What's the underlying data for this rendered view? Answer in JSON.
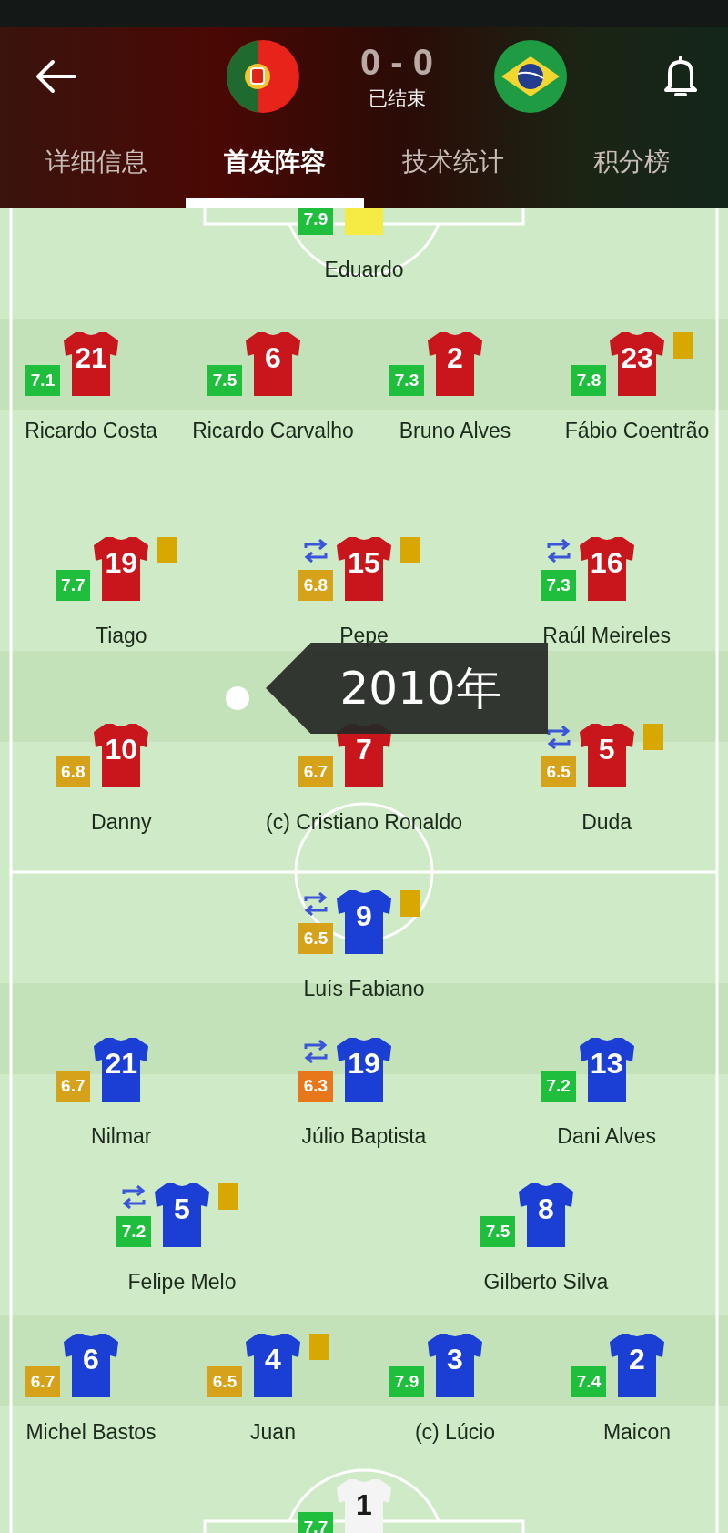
{
  "header": {
    "score": "0 - 0",
    "status": "已结束"
  },
  "tabs": [
    {
      "label": "详细信息",
      "selected": false
    },
    {
      "label": "首发阵容",
      "selected": true
    },
    {
      "label": "技术统计",
      "selected": false
    },
    {
      "label": "积分榜",
      "selected": false
    }
  ],
  "teams": [
    {
      "color": "#c9161c",
      "goalkeeper": {
        "name": "Eduardo",
        "rating": "7.9",
        "color": "#1fbe3c",
        "jersey": {
          "color": "#f6ea45"
        }
      },
      "lines": [
        [
          {
            "name": "Ricardo Costa",
            "number": "21",
            "rating": "7.1",
            "color": "#1fbe3c",
            "substituted": false,
            "yellow_card": false
          },
          {
            "name": "Ricardo Carvalho",
            "number": "6",
            "rating": "7.5",
            "color": "#1fbe3c",
            "substituted": false,
            "yellow_card": false
          },
          {
            "name": "Bruno Alves",
            "number": "2",
            "rating": "7.3",
            "color": "#1fbe3c",
            "substituted": false,
            "yellow_card": false
          },
          {
            "name": "Fábio Coentrão",
            "number": "23",
            "rating": "7.8",
            "color": "#1fbe3c",
            "substituted": false,
            "yellow_card": true
          }
        ],
        [
          {
            "name": "Tiago",
            "number": "19",
            "rating": "7.7",
            "color": "#1fbe3c",
            "substituted": false,
            "yellow_card": true
          },
          {
            "name": "Pepe",
            "number": "15",
            "rating": "6.8",
            "color": "#d6a21a",
            "substituted": true,
            "yellow_card": true
          },
          {
            "name": "Raúl Meireles",
            "number": "16",
            "rating": "7.3",
            "color": "#1fbe3c",
            "substituted": true,
            "yellow_card": false
          }
        ],
        [
          {
            "name": "Danny",
            "number": "10",
            "rating": "6.8",
            "color": "#d6a21a",
            "substituted": false,
            "yellow_card": false
          },
          {
            "name": "(c) Cristiano Ronaldo",
            "number": "7",
            "rating": "6.7",
            "color": "#d6a21a",
            "substituted": false,
            "yellow_card": false
          },
          {
            "name": "Duda",
            "number": "5",
            "rating": "6.5",
            "color": "#d6a21a",
            "substituted": true,
            "yellow_card": true
          }
        ]
      ]
    },
    {
      "color": "#1b3fd4",
      "goalkeeper": {
        "number": "1",
        "rating": "7.7",
        "color": "#1fbe3c",
        "jersey": {
          "color": "#f4f4f4"
        }
      },
      "lines": [
        [
          {
            "name": "Luís Fabiano",
            "number": "9",
            "rating": "6.5",
            "color": "#d6a21a",
            "substituted": true,
            "yellow_card": true
          }
        ],
        [
          {
            "name": "Nilmar",
            "number": "21",
            "rating": "6.7",
            "color": "#d6a21a",
            "substituted": false,
            "yellow_card": false
          },
          {
            "name": "Júlio Baptista",
            "number": "19",
            "rating": "6.3",
            "color": "#e8771c",
            "substituted": true,
            "yellow_card": false
          },
          {
            "name": "Dani Alves",
            "number": "13",
            "rating": "7.2",
            "color": "#1fbe3c",
            "substituted": false,
            "yellow_card": false
          }
        ],
        [
          {
            "name": "Felipe Melo",
            "number": "5",
            "rating": "7.2",
            "color": "#1fbe3c",
            "substituted": true,
            "yellow_card": true
          },
          {
            "name": "Gilberto Silva",
            "number": "8",
            "rating": "7.5",
            "color": "#1fbe3c",
            "substituted": false,
            "yellow_card": false
          }
        ],
        [
          {
            "name": "Michel Bastos",
            "number": "6",
            "rating": "6.7",
            "color": "#d6a21a",
            "substituted": false,
            "yellow_card": false
          },
          {
            "name": "Juan",
            "number": "4",
            "rating": "6.5",
            "color": "#d6a21a",
            "substituted": false,
            "yellow_card": true
          },
          {
            "name": "(c) Lúcio",
            "number": "3",
            "rating": "7.9",
            "color": "#1fbe3c",
            "substituted": false,
            "yellow_card": false
          },
          {
            "name": "Maicon",
            "number": "2",
            "rating": "7.4",
            "color": "#1fbe3c",
            "substituted": false,
            "yellow_card": false
          }
        ]
      ]
    }
  ],
  "tooltip": {
    "text": "2010年"
  }
}
